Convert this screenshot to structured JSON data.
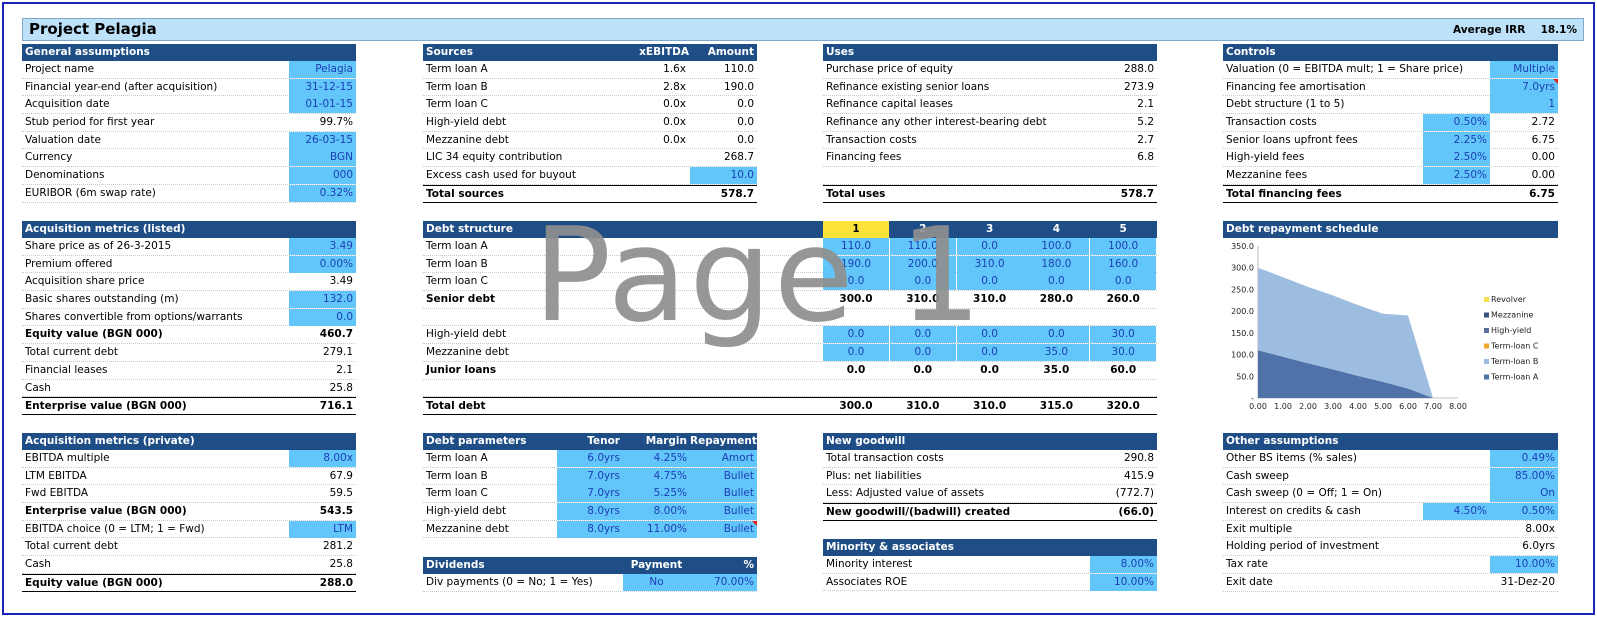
{
  "title": "Project Pelagia",
  "irr": {
    "label": "Average IRR",
    "value": "18.1%"
  },
  "general": {
    "header": "General assumptions",
    "rows": [
      {
        "label": "Project name",
        "value": "Pelagia",
        "input": true
      },
      {
        "label": "Financial year-end (after acquisition)",
        "value": "31-12-15",
        "input": true
      },
      {
        "label": "Acquisition date",
        "value": "01-01-15",
        "input": true
      },
      {
        "label": "Stub period for first year",
        "value": "99.7%",
        "input": false
      },
      {
        "label": "Valuation date",
        "value": "26-03-15",
        "input": true
      },
      {
        "label": "Currency",
        "value": "BGN",
        "input": true
      },
      {
        "label": "Denominations",
        "value": "000",
        "input": true
      },
      {
        "label": "EURIBOR (6m swap rate)",
        "value": "0.32%",
        "input": true
      }
    ]
  },
  "sources": {
    "header": "Sources",
    "col1": "xEBITDA",
    "col2": "Amount",
    "rows": [
      {
        "label": "Term loan A",
        "x": "1.6x",
        "amt": "110.0"
      },
      {
        "label": "Term loan B",
        "x": "2.8x",
        "amt": "190.0"
      },
      {
        "label": "Term loan C",
        "x": "0.0x",
        "amt": "0.0"
      },
      {
        "label": "High-yield debt",
        "x": "0.0x",
        "amt": "0.0"
      },
      {
        "label": "Mezzanine debt",
        "x": "0.0x",
        "amt": "0.0"
      },
      {
        "label": "LIC 34 equity contribution",
        "x": "",
        "amt": "268.7"
      },
      {
        "label": "Excess cash used for buyout",
        "x": "",
        "amt": "10.0"
      }
    ],
    "total_label": "Total sources",
    "total": "578.7"
  },
  "uses": {
    "header": "Uses",
    "rows": [
      {
        "label": "Purchase price of equity",
        "value": "288.0"
      },
      {
        "label": "Refinance existing senior loans",
        "value": "273.9"
      },
      {
        "label": "Refinance capital leases",
        "value": "2.1"
      },
      {
        "label": "Refinance any other interest-bearing debt",
        "value": "5.2"
      },
      {
        "label": "Transaction costs",
        "value": "2.7"
      },
      {
        "label": "Financing fees",
        "value": "6.8"
      }
    ],
    "total_label": "Total uses",
    "total": "578.7"
  },
  "controls": {
    "header": "Controls",
    "rows": [
      {
        "label": "Valuation (0 = EBITDA mult; 1 = Share price)",
        "pct": "",
        "value": "Multiple"
      },
      {
        "label": "Financing fee amortisation",
        "pct": "",
        "value": "7.0yrs"
      },
      {
        "label": "Debt structure (1 to 5)",
        "pct": "",
        "value": "1"
      },
      {
        "label": "Transaction costs",
        "pct": "0.50%",
        "value": "2.72"
      },
      {
        "label": "Senior loans upfront fees",
        "pct": "2.25%",
        "value": "6.75"
      },
      {
        "label": "High-yield fees",
        "pct": "2.50%",
        "value": "0.00"
      },
      {
        "label": "Mezzanine fees",
        "pct": "2.50%",
        "value": "0.00"
      }
    ],
    "total_label": "Total financing fees",
    "total": "6.75"
  },
  "acq_listed": {
    "header": "Acquisition metrics (listed)",
    "rows": [
      {
        "label": "Share price as of 26-3-2015",
        "value": "3.49",
        "input": true,
        "bold": false
      },
      {
        "label": "Premium offered",
        "value": "0.00%",
        "input": true,
        "bold": false
      },
      {
        "label": "Acquisition share price",
        "value": "3.49",
        "input": false,
        "bold": false
      },
      {
        "label": "Basic shares outstanding (m)",
        "value": "132.0",
        "input": true,
        "bold": false
      },
      {
        "label": "Shares convertible from options/warrants",
        "value": "0.0",
        "input": true,
        "bold": false
      },
      {
        "label": "Equity value (BGN 000)",
        "value": "460.7",
        "input": false,
        "bold": true
      },
      {
        "label": "Total current debt",
        "value": "279.1",
        "input": false,
        "bold": false
      },
      {
        "label": "Financial leases",
        "value": "2.1",
        "input": false,
        "bold": false
      },
      {
        "label": "Cash",
        "value": "25.8",
        "input": false,
        "bold": false
      }
    ],
    "total_label": "Enterprise value (BGN 000)",
    "total": "716.1"
  },
  "debt_structure": {
    "header": "Debt structure",
    "cols": [
      "1",
      "2",
      "3",
      "4",
      "5"
    ],
    "senior": [
      {
        "label": "Term loan A",
        "vals": [
          "110.0",
          "110.0",
          "0.0",
          "100.0",
          "100.0"
        ]
      },
      {
        "label": "Term loan B",
        "vals": [
          "190.0",
          "200.0",
          "310.0",
          "180.0",
          "160.0"
        ]
      },
      {
        "label": "Term loan C",
        "vals": [
          "0.0",
          "0.0",
          "0.0",
          "0.0",
          "0.0"
        ]
      }
    ],
    "senior_total": {
      "label": "Senior debt",
      "vals": [
        "300.0",
        "310.0",
        "310.0",
        "280.0",
        "260.0"
      ]
    },
    "junior": [
      {
        "label": "High-yield debt",
        "vals": [
          "0.0",
          "0.0",
          "0.0",
          "0.0",
          "30.0"
        ]
      },
      {
        "label": "Mezzanine debt",
        "vals": [
          "0.0",
          "0.0",
          "0.0",
          "35.0",
          "30.0"
        ]
      }
    ],
    "junior_total": {
      "label": "Junior loans",
      "vals": [
        "0.0",
        "0.0",
        "0.0",
        "35.0",
        "60.0"
      ]
    },
    "total": {
      "label": "Total debt",
      "vals": [
        "300.0",
        "310.0",
        "310.0",
        "315.0",
        "320.0"
      ]
    }
  },
  "watermark": "Page 1",
  "chart_data": {
    "type": "area",
    "title": "Debt repayment schedule",
    "x": [
      0,
      1,
      2,
      3,
      4,
      5,
      6,
      7,
      8
    ],
    "xlim": [
      0,
      8
    ],
    "ylim": [
      0,
      350
    ],
    "x_ticks": [
      "0.00",
      "1.00",
      "2.00",
      "3.00",
      "4.00",
      "5.00",
      "6.00",
      "7.00",
      "8.00"
    ],
    "y_ticks": [
      "-",
      "50.0",
      "100.0",
      "150.0",
      "200.0",
      "250.0",
      "300.0",
      "350.0"
    ],
    "legend_position": "right",
    "legend": [
      "Revolver",
      "Mezzanine",
      "High-yield",
      "Term-loan C",
      "Term-loan B",
      "Term-loan A"
    ],
    "series": [
      {
        "name": "Term-loan A",
        "color": "#4f73a8",
        "values": [
          110,
          95,
          80,
          66,
          51,
          37,
          22,
          0,
          0
        ]
      },
      {
        "name": "Term-loan B",
        "color": "#9dbde0",
        "values": [
          190,
          183,
          176,
          170,
          163,
          157,
          168,
          0,
          0
        ]
      },
      {
        "name": "Term-loan C",
        "color": "#f0a830",
        "values": [
          0,
          0,
          0,
          0,
          0,
          0,
          0,
          0,
          0
        ]
      },
      {
        "name": "High-yield",
        "color": "#5a6fa0",
        "values": [
          0,
          0,
          0,
          0,
          0,
          0,
          0,
          0,
          0
        ]
      },
      {
        "name": "Mezzanine",
        "color": "#3b4f80",
        "values": [
          0,
          0,
          0,
          0,
          0,
          0,
          0,
          0,
          0
        ]
      },
      {
        "name": "Revolver",
        "color": "#f7df4a",
        "values": [
          0,
          0,
          0,
          0,
          0,
          0,
          0,
          0,
          0
        ]
      }
    ]
  },
  "acq_private": {
    "header": "Acquisition metrics (private)",
    "rows": [
      {
        "label": "EBITDA multiple",
        "value": "8.00x",
        "input": true,
        "bold": false
      },
      {
        "label": "LTM EBITDA",
        "value": "67.9",
        "input": false,
        "bold": false
      },
      {
        "label": "Fwd EBITDA",
        "value": "59.5",
        "input": false,
        "bold": false
      },
      {
        "label": "Enterprise value (BGN 000)",
        "value": "543.5",
        "input": false,
        "bold": true
      },
      {
        "label": "EBITDA choice (0 = LTM; 1 = Fwd)",
        "value": "LTM",
        "input": true,
        "bold": false
      },
      {
        "label": "Total current debt",
        "value": "281.2",
        "input": false,
        "bold": false
      },
      {
        "label": "Cash",
        "value": "25.8",
        "input": false,
        "bold": false
      }
    ],
    "total_label": "Equity value (BGN 000)",
    "total": "288.0"
  },
  "debt_params": {
    "header": "Debt parameters",
    "cols": [
      "Tenor",
      "Margin",
      "Repayment"
    ],
    "rows": [
      {
        "label": "Term loan A",
        "tenor": "6.0yrs",
        "margin": "4.25%",
        "rep": "Amort"
      },
      {
        "label": "Term loan B",
        "tenor": "7.0yrs",
        "margin": "4.75%",
        "rep": "Bullet"
      },
      {
        "label": "Term loan C",
        "tenor": "7.0yrs",
        "margin": "5.25%",
        "rep": "Bullet"
      },
      {
        "label": "High-yield debt",
        "tenor": "8.0yrs",
        "margin": "8.00%",
        "rep": "Bullet"
      },
      {
        "label": "Mezzanine debt",
        "tenor": "8.0yrs",
        "margin": "11.00%",
        "rep": "Bullet"
      }
    ]
  },
  "dividends": {
    "header": "Dividends",
    "col1": "Payment",
    "col2": "%",
    "label": "Div payments (0 = No; 1 = Yes)",
    "payment": "No",
    "pct": "70.00%"
  },
  "goodwill": {
    "header": "New goodwill",
    "rows": [
      {
        "label": "Total transaction costs",
        "value": "290.8"
      },
      {
        "label": "Plus: net liabilities",
        "value": "415.9"
      },
      {
        "label": "Less: Adjusted value of assets",
        "value": "(772.7)"
      }
    ],
    "total_label": "New goodwill/(badwill) created",
    "total": "(66.0)"
  },
  "minority": {
    "header": "Minority & associates",
    "rows": [
      {
        "label": "Minority interest",
        "value": "8.00%"
      },
      {
        "label": "Associates ROE",
        "value": "10.00%"
      }
    ]
  },
  "other": {
    "header": "Other assumptions",
    "rows": [
      {
        "label": "Other BS items (% sales)",
        "pct": "",
        "value": "0.49%",
        "input": true
      },
      {
        "label": "Cash sweep",
        "pct": "",
        "value": "85.00%",
        "input": true
      },
      {
        "label": "Cash sweep (0 = Off; 1 = On)",
        "pct": "",
        "value": "On",
        "input": true
      },
      {
        "label": "Interest on credits & cash",
        "pct": "4.50%",
        "value": "0.50%",
        "input": true
      },
      {
        "label": "Exit multiple",
        "pct": "",
        "value": "8.00x",
        "input": false
      },
      {
        "label": "Holding period of investment",
        "pct": "",
        "value": "6.0yrs",
        "input": false
      },
      {
        "label": "Tax rate",
        "pct": "",
        "value": "10.00%",
        "input": true
      },
      {
        "label": "Exit date",
        "pct": "",
        "value": "31-Dez-20",
        "input": false
      }
    ]
  }
}
